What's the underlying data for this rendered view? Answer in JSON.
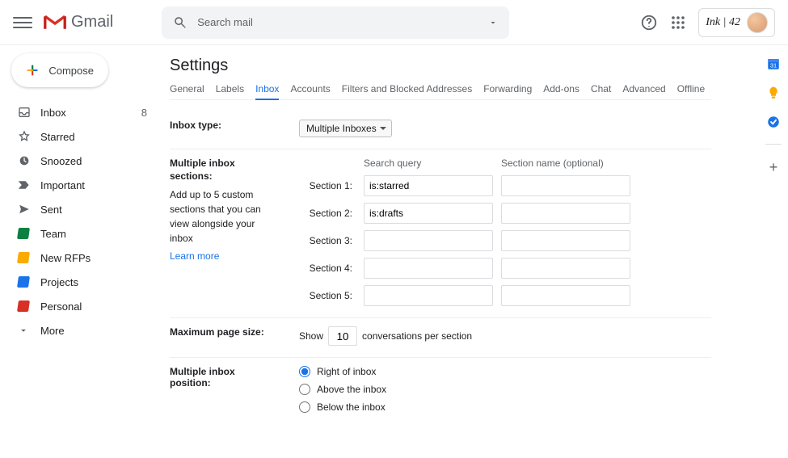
{
  "header": {
    "app_name": "Gmail",
    "search_placeholder": "Search mail",
    "account_badge": "Ink | 42"
  },
  "sidebar": {
    "compose_label": "Compose",
    "items": [
      {
        "label": "Inbox",
        "count": "8",
        "icon": "inbox"
      },
      {
        "label": "Starred",
        "icon": "star"
      },
      {
        "label": "Snoozed",
        "icon": "clock"
      },
      {
        "label": "Important",
        "icon": "important"
      },
      {
        "label": "Sent",
        "icon": "sent"
      },
      {
        "label": "Team",
        "color": "#0b8043"
      },
      {
        "label": "New RFPs",
        "color": "#f9ab00"
      },
      {
        "label": "Projects",
        "color": "#1a73e8"
      },
      {
        "label": "Personal",
        "color": "#d93025"
      },
      {
        "label": "More",
        "icon": "chevron-down"
      }
    ]
  },
  "settings": {
    "title": "Settings",
    "tabs": [
      "General",
      "Labels",
      "Inbox",
      "Accounts",
      "Filters and Blocked Addresses",
      "Forwarding",
      "Add-ons",
      "Chat",
      "Advanced",
      "Offline"
    ],
    "active_tab": "Inbox",
    "inbox_type": {
      "label": "Inbox type:",
      "value": "Multiple Inboxes"
    },
    "multiple_sections": {
      "label": "Multiple inbox sections:",
      "desc": "Add up to 5 custom sections that you can view alongside your inbox",
      "learn_more": "Learn more",
      "col_query": "Search query",
      "col_name": "Section name (optional)",
      "rows": [
        {
          "label": "Section 1:",
          "query": "is:starred",
          "name": ""
        },
        {
          "label": "Section 2:",
          "query": "is:drafts",
          "name": ""
        },
        {
          "label": "Section 3:",
          "query": "",
          "name": ""
        },
        {
          "label": "Section 4:",
          "query": "",
          "name": ""
        },
        {
          "label": "Section 5:",
          "query": "",
          "name": ""
        }
      ]
    },
    "page_size": {
      "label": "Maximum page size:",
      "prefix": "Show",
      "value": "10",
      "suffix": "conversations per section"
    },
    "position": {
      "label": "Multiple inbox position:",
      "options": [
        "Right of inbox",
        "Above the inbox",
        "Below the inbox"
      ],
      "selected": "Right of inbox"
    }
  }
}
